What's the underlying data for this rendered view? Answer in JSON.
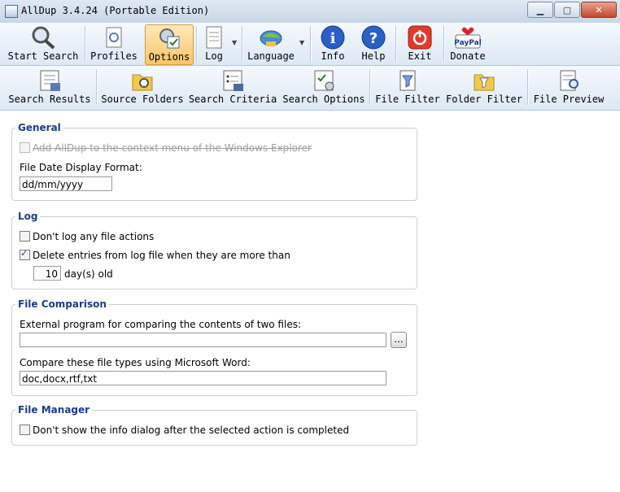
{
  "window": {
    "title": "AllDup 3.4.24 (Portable Edition)"
  },
  "toolbar_main": [
    {
      "label": "Start Search",
      "icon": "magnifier-icon"
    },
    {
      "label": "Profiles",
      "icon": "profiles-icon"
    },
    {
      "label": "Options",
      "icon": "options-icon",
      "active": true
    },
    {
      "label": "Log",
      "icon": "log-icon"
    },
    {
      "label": "Language",
      "icon": "language-icon"
    },
    {
      "label": "Info",
      "icon": "info-icon"
    },
    {
      "label": "Help",
      "icon": "help-icon"
    },
    {
      "label": "Exit",
      "icon": "exit-icon"
    },
    {
      "label": "Donate",
      "icon": "paypal-icon"
    }
  ],
  "toolbar_sub": [
    {
      "label": "Search Results"
    },
    {
      "label": "Source Folders"
    },
    {
      "label": "Search Criteria"
    },
    {
      "label": "Search Options"
    },
    {
      "label": "File Filter"
    },
    {
      "label": "Folder Filter"
    },
    {
      "label": "File Preview"
    }
  ],
  "paypal_text": "PayPal",
  "general": {
    "legend": "General",
    "context_menu": "Add AllDup to the context menu of the Windows Explorer",
    "date_format_label": "File Date Display Format:",
    "date_format_value": "dd/mm/yyyy"
  },
  "log": {
    "legend": "Log",
    "dont_log": "Don't log any file actions",
    "delete_entries": "Delete entries from log file when they are more than",
    "days_value": "10",
    "days_label": "day(s) old"
  },
  "file_comparison": {
    "legend": "File Comparison",
    "external_label": "External program for comparing the contents of two files:",
    "external_value": "",
    "browse": "...",
    "word_label": "Compare these file types using Microsoft Word:",
    "word_value": "doc,docx,rtf,txt"
  },
  "file_manager": {
    "legend": "File Manager",
    "dont_show": "Don't show the info dialog after the selected action is completed"
  }
}
